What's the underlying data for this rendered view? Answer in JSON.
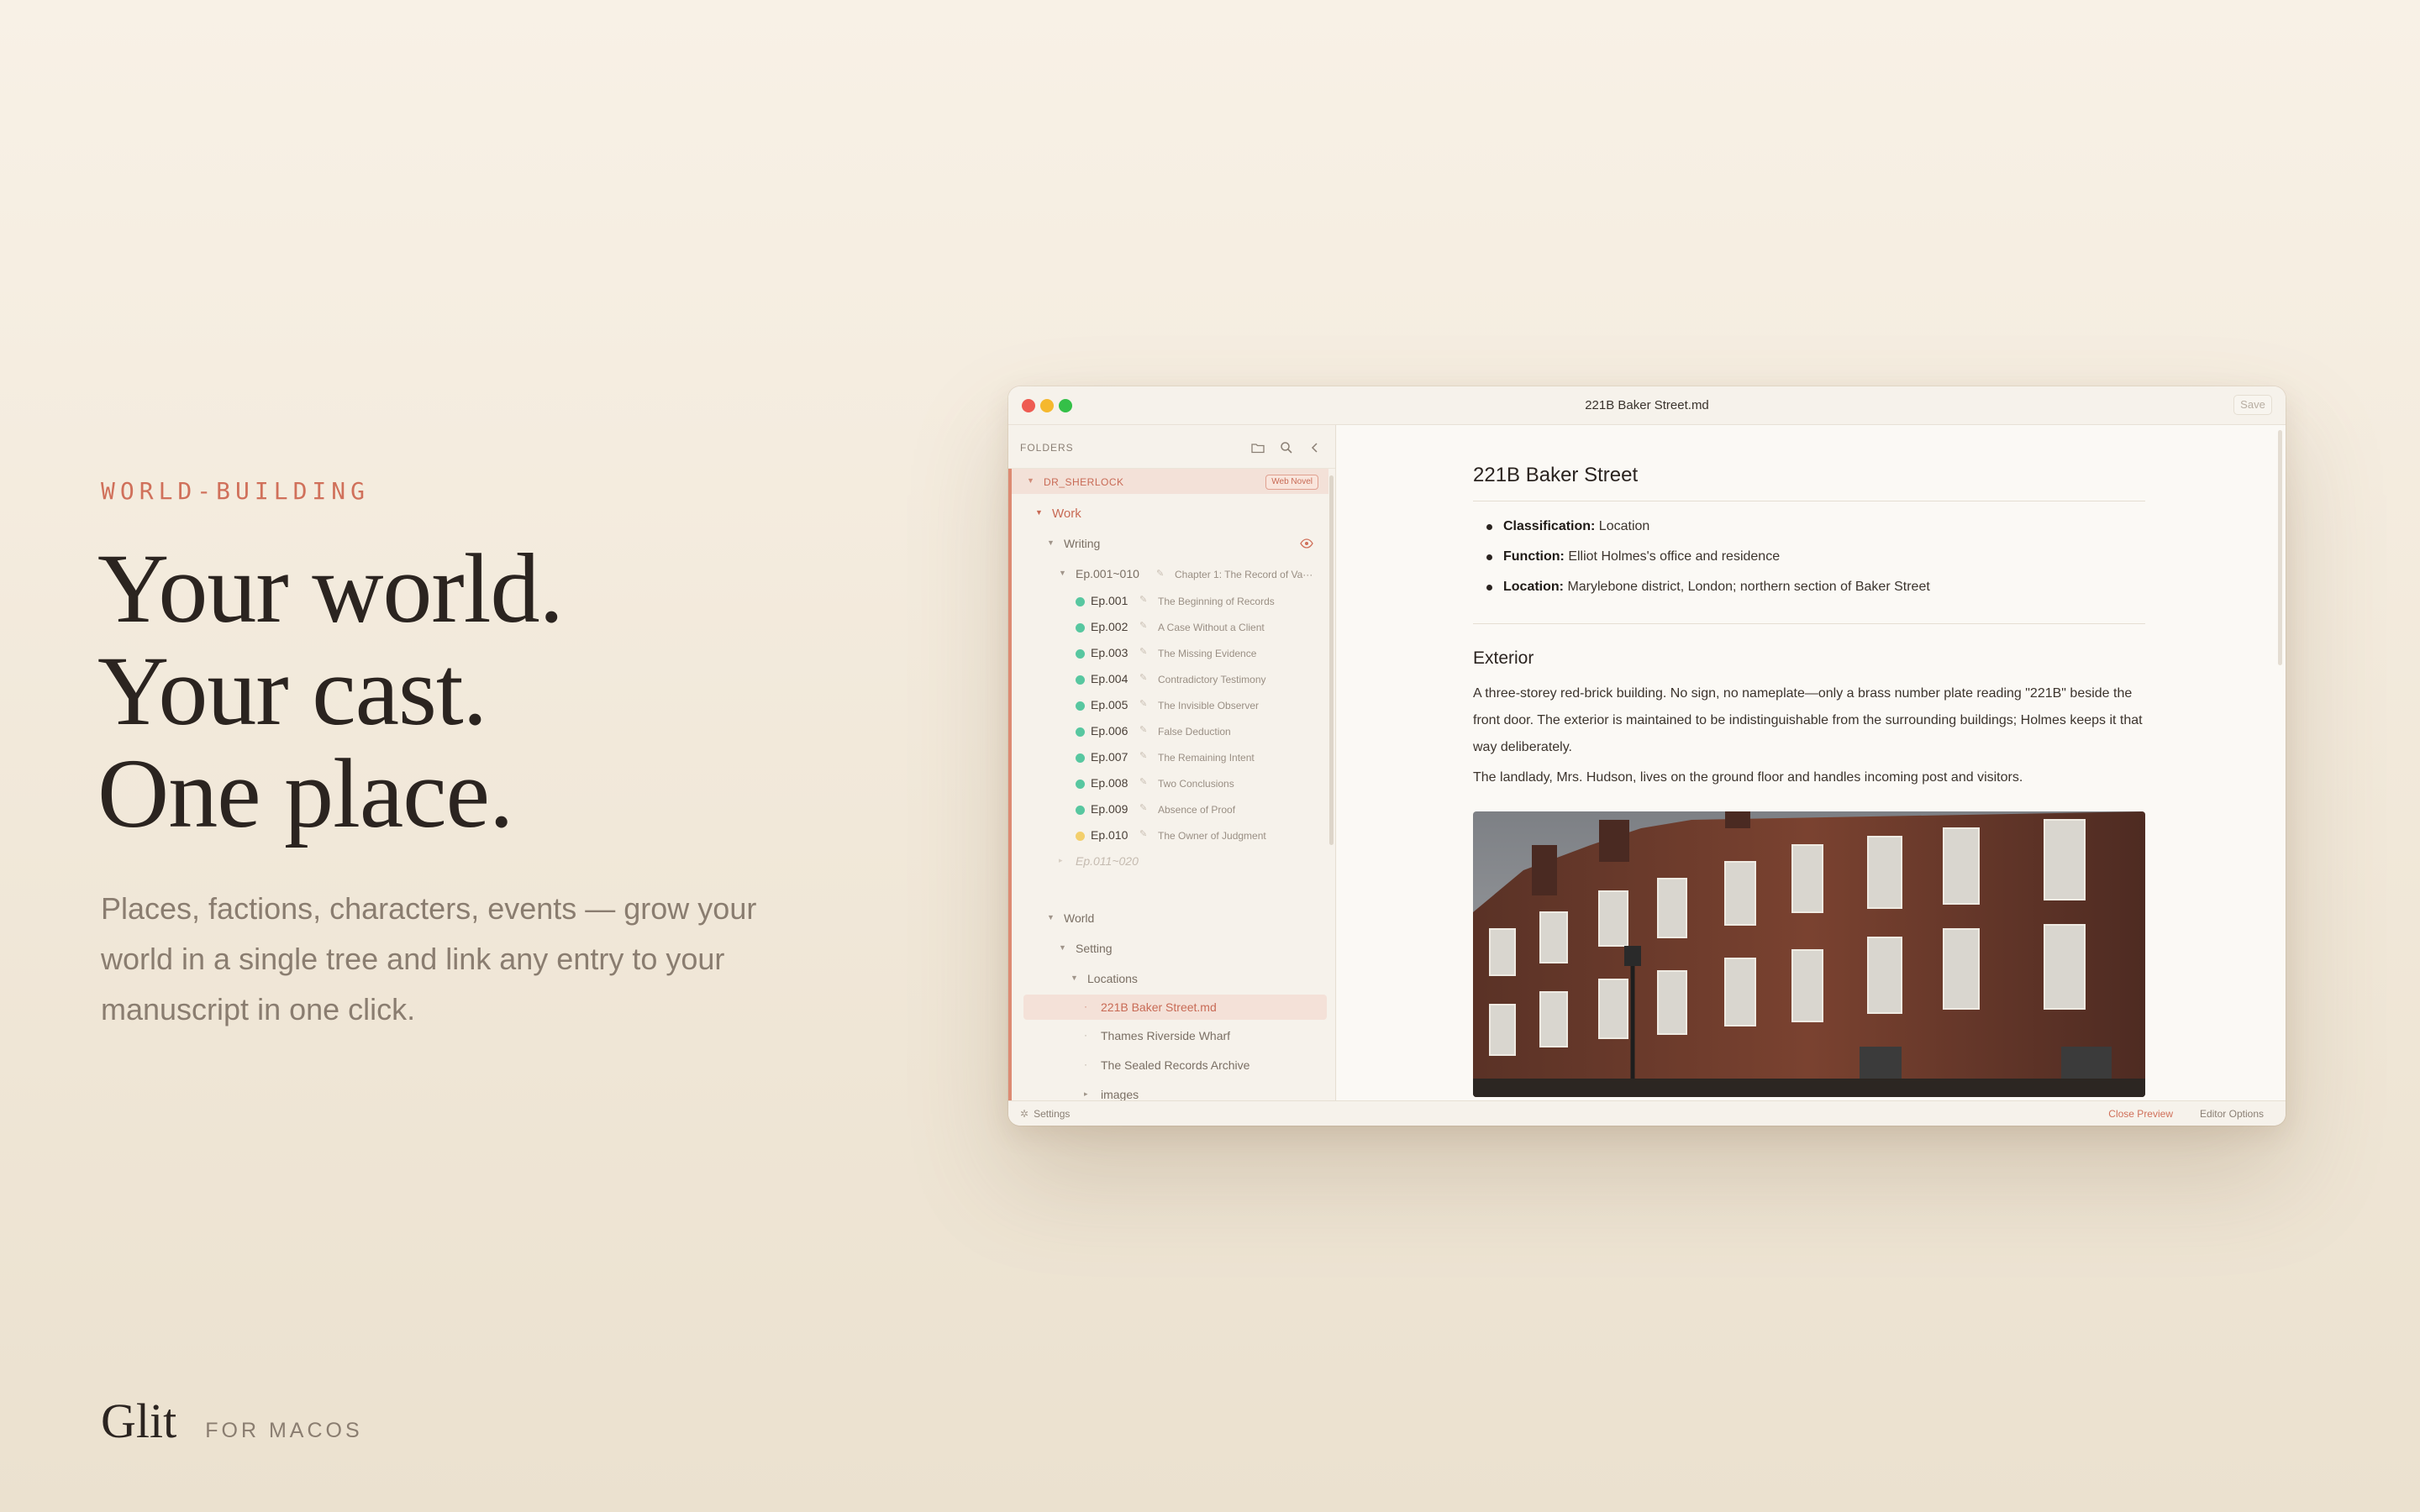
{
  "marketing": {
    "eyebrow": "WORLD-BUILDING",
    "headline": [
      "Your world.",
      "Your cast.",
      "One place."
    ],
    "subcopy": "Places, factions, characters, events — grow your world in a single tree and link any entry to your manuscript in one click.",
    "brand_name": "Glit",
    "brand_tag": "FOR MACOS"
  },
  "window": {
    "title": "221B Baker Street.md",
    "save_label": "Save"
  },
  "sidebar": {
    "header": "FOLDERS",
    "icons": [
      "folder-icon",
      "search-icon",
      "chevron-left-icon"
    ],
    "root": {
      "label": "DR_SHERLOCK",
      "badge": "Web Novel"
    },
    "work": "Work",
    "writing": "Writing",
    "chapter_group": {
      "code": "Ep.001~010",
      "title": "Chapter 1: The Record of Va···"
    },
    "episodes": [
      {
        "code": "Ep.001",
        "title": "The Beginning of Records",
        "status": "done"
      },
      {
        "code": "Ep.002",
        "title": "A Case Without a Client",
        "status": "done"
      },
      {
        "code": "Ep.003",
        "title": "The Missing Evidence",
        "status": "done"
      },
      {
        "code": "Ep.004",
        "title": "Contradictory Testimony",
        "status": "done"
      },
      {
        "code": "Ep.005",
        "title": "The Invisible Observer",
        "status": "done"
      },
      {
        "code": "Ep.006",
        "title": "False Deduction",
        "status": "done"
      },
      {
        "code": "Ep.007",
        "title": "The Remaining Intent",
        "status": "done"
      },
      {
        "code": "Ep.008",
        "title": "Two Conclusions",
        "status": "done"
      },
      {
        "code": "Ep.009",
        "title": "Absence of Proof",
        "status": "done"
      },
      {
        "code": "Ep.010",
        "title": "The Owner of Judgment",
        "status": "draft"
      }
    ],
    "next_group": "Ep.011~020",
    "world": "World",
    "setting": "Setting",
    "locations": "Locations",
    "location_files": [
      "221B Baker Street.md",
      "Thames Riverside Wharf",
      "The Sealed Records Archive"
    ],
    "images_folder": "images",
    "colors": {
      "done": "#58c7a0",
      "draft": "#f3cf6c",
      "accent": "#c86a55"
    }
  },
  "statusbar": {
    "settings": "Settings",
    "close_preview": "Close Preview",
    "editor_options": "Editor Options"
  },
  "document": {
    "title": "221B Baker Street",
    "facts": [
      {
        "key": "Classification:",
        "value": " Location"
      },
      {
        "key": "Function:",
        "value": " Elliot Holmes's office and residence"
      },
      {
        "key": "Location:",
        "value": " Marylebone district, London; northern section of Baker Street"
      }
    ],
    "section": "Exterior",
    "paragraphs": [
      "A three-storey red-brick building. No sign, no nameplate—only a brass number plate reading \"221B\" beside the front door. The exterior is maintained to be indistinguishable from the surrounding buildings; Holmes keeps it that way deliberately.",
      "The landlady, Mrs. Hudson, lives on the ground floor and handles incoming post and visitors."
    ]
  }
}
